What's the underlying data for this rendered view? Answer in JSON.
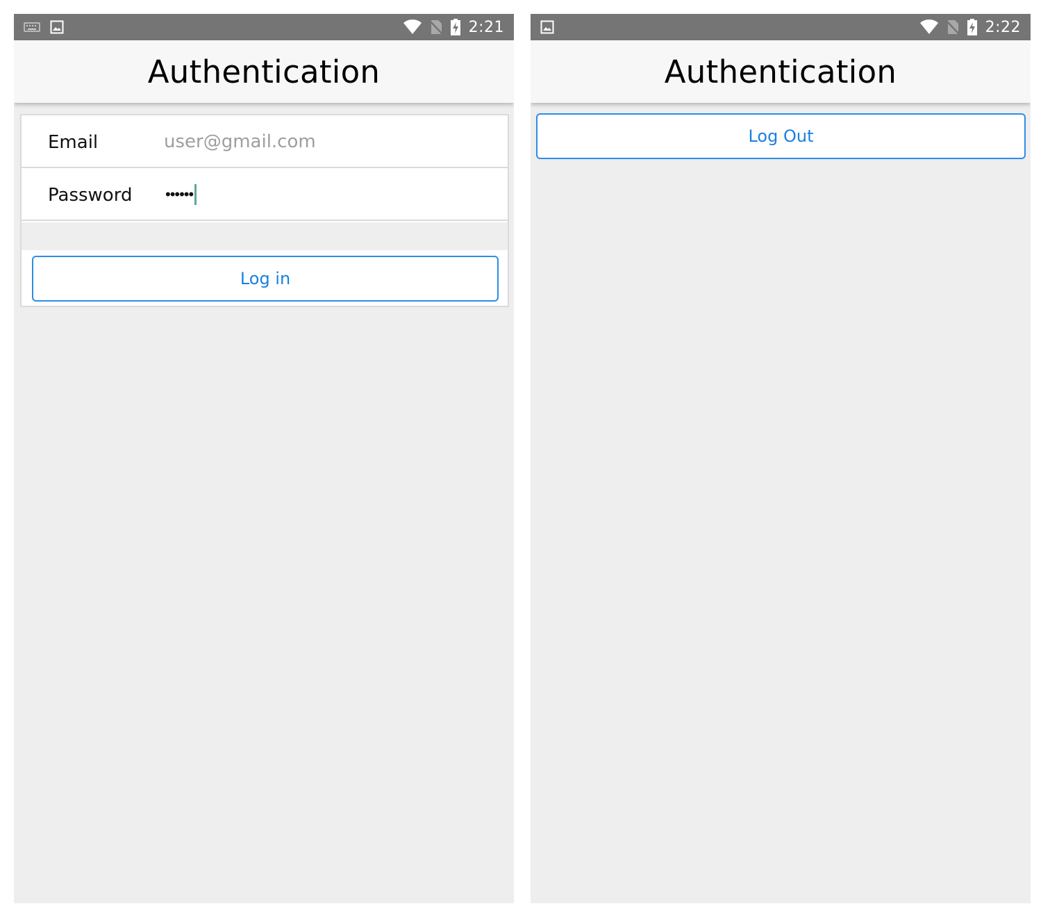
{
  "left_screen": {
    "status_bar": {
      "time": "2:21",
      "left_icons": [
        "keyboard-icon",
        "image-icon"
      ],
      "right_icons": [
        "wifi-icon",
        "no-sim-icon",
        "battery-charging-icon"
      ]
    },
    "title": "Authentication",
    "email": {
      "label": "Email",
      "placeholder": "user@gmail.com",
      "value": ""
    },
    "password": {
      "label": "Password",
      "masked_value": "••••••"
    },
    "login_button": "Log in"
  },
  "right_screen": {
    "status_bar": {
      "time": "2:22",
      "left_icons": [
        "image-icon"
      ],
      "right_icons": [
        "wifi-icon",
        "no-sim-icon",
        "battery-charging-icon"
      ]
    },
    "title": "Authentication",
    "logout_button": "Log Out"
  },
  "colors": {
    "status_bar": "#757575",
    "nav_bar": "#f7f7f7",
    "background": "#eeeeee",
    "accent": "#2a8de8",
    "cursor": "#5aa89a"
  }
}
